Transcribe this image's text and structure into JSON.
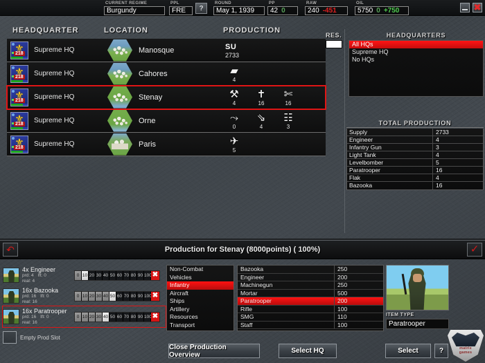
{
  "topbar": {
    "regime_label": "CURRENT REGIME",
    "regime_value": "Burgundy",
    "ppl_label": "PPL",
    "ppl_value": "FRE",
    "help_glyph": "?",
    "round_label": "ROUND",
    "round_value": "May 1, 1939",
    "pp_label": "PP",
    "pp_value": "42",
    "pp_delta": "0",
    "raw_label": "RAW",
    "raw_value": "240",
    "raw_delta": "-451",
    "oil_label": "OIL",
    "oil_value": "5750",
    "oil_delta": "0",
    "oil_delta2": "+750",
    "minimize_glyph": "",
    "close_glyph": "✖"
  },
  "hq_table": {
    "headers": {
      "headquarter": "HEADQUARTER",
      "location": "LOCATION",
      "production": "PRODUCTION"
    },
    "rows": [
      {
        "unit_name": "Supreme HQ",
        "unit_badge": "218",
        "terrain": "water",
        "location": "Manosque",
        "selected": false,
        "supply": {
          "label": "SU",
          "value": "2733"
        },
        "items": []
      },
      {
        "unit_name": "Supreme HQ",
        "unit_badge": "218",
        "terrain": "water",
        "location": "Cahores",
        "selected": false,
        "supply": null,
        "items": [
          {
            "icon": "light-tank-icon",
            "glyph": "▰",
            "count": "4"
          }
        ]
      },
      {
        "unit_name": "Supreme HQ",
        "unit_badge": "218",
        "terrain": "land",
        "location": "Stenay",
        "selected": true,
        "supply": null,
        "items": [
          {
            "icon": "engineer-icon",
            "glyph": "⚒",
            "count": "4"
          },
          {
            "icon": "bazooka-icon",
            "glyph": "✝",
            "count": "16"
          },
          {
            "icon": "paratrooper-icon",
            "glyph": "✄",
            "count": "16"
          }
        ]
      },
      {
        "unit_name": "Supreme HQ",
        "unit_badge": "218",
        "terrain": "land2",
        "location": "Orne",
        "selected": false,
        "supply": null,
        "items": [
          {
            "icon": "flak-icon",
            "glyph": "⤳",
            "count": "0"
          },
          {
            "icon": "infantry-gun-icon",
            "glyph": "⇘",
            "count": "4"
          },
          {
            "icon": "light-tank-icon",
            "glyph": "☷",
            "count": "3"
          }
        ]
      },
      {
        "unit_name": "Supreme HQ",
        "unit_badge": "218",
        "terrain": "city",
        "location": "Paris",
        "selected": false,
        "supply": null,
        "items": [
          {
            "icon": "levelbomber-icon",
            "glyph": "✈",
            "count": "5"
          }
        ]
      }
    ]
  },
  "res": {
    "label": "RES.",
    "value": ""
  },
  "hq_filter": {
    "title": "HEADQUARTERS",
    "options": [
      {
        "label": "All HQs",
        "selected": true
      },
      {
        "label": "Supreme HQ",
        "selected": false
      },
      {
        "label": "No HQs",
        "selected": false
      }
    ]
  },
  "total_production": {
    "title": "TOTAL PRODUCTION",
    "rows": [
      {
        "name": "Supply",
        "value": "2733"
      },
      {
        "name": "Engineer",
        "value": "4"
      },
      {
        "name": "Infantry Gun",
        "value": "3"
      },
      {
        "name": "Light Tank",
        "value": "4"
      },
      {
        "name": "Levelbomber",
        "value": "5"
      },
      {
        "name": "Paratrooper",
        "value": "16"
      },
      {
        "name": "Flak",
        "value": "4"
      },
      {
        "name": "Bazooka",
        "value": "16"
      }
    ]
  },
  "production_panel": {
    "title": "Production for Stenay (8000points) ( 100%)",
    "back_glyph": "↶",
    "ok_glyph": "✓",
    "slots": [
      {
        "title": "4x Engineer",
        "prd": "prd: 4",
        "lft": "lft: 0",
        "real": "real: 4",
        "percent": 10,
        "selected": false,
        "remove_glyph": "✖"
      },
      {
        "title": "16x Bazooka",
        "prd": "prd: 16",
        "lft": "lft: 0",
        "real": "real: 16",
        "percent": 50,
        "selected": false,
        "remove_glyph": "✖"
      },
      {
        "title": "16x Paratrooper",
        "prd": "prd: 16",
        "lft": "lft: 0",
        "real": "real: 16",
        "percent": 40,
        "selected": true,
        "remove_glyph": "✖"
      }
    ],
    "slider_ticks": [
      "0",
      "10",
      "20",
      "30",
      "40",
      "50",
      "60",
      "70",
      "80",
      "90",
      "100"
    ],
    "empty_slot_label": "Empty Prod Slot",
    "categories": [
      {
        "label": "Non-Combat",
        "selected": false
      },
      {
        "label": "Vehicles",
        "selected": false
      },
      {
        "label": "Infantry",
        "selected": true
      },
      {
        "label": "Aircraft",
        "selected": false
      },
      {
        "label": "Ships",
        "selected": false
      },
      {
        "label": "Artillery",
        "selected": false
      },
      {
        "label": "Resources",
        "selected": false
      },
      {
        "label": "Transport",
        "selected": false
      }
    ],
    "items": [
      {
        "name": "Bazooka",
        "cost": "250",
        "selected": false
      },
      {
        "name": "Engineer",
        "cost": "200",
        "selected": false
      },
      {
        "name": "Machinegun",
        "cost": "250",
        "selected": false
      },
      {
        "name": "Mortar",
        "cost": "500",
        "selected": false
      },
      {
        "name": "Paratrooper",
        "cost": "200",
        "selected": true
      },
      {
        "name": "Rifle",
        "cost": "100",
        "selected": false
      },
      {
        "name": "SMG",
        "cost": "110",
        "selected": false
      },
      {
        "name": "Staff",
        "cost": "100",
        "selected": false
      }
    ],
    "item_type_label": "ITEM TYPE",
    "item_type_value": "Paratrooper"
  },
  "footer": {
    "close_production_overview": "Close Production Overview",
    "select_hq": "Select HQ",
    "select": "Select",
    "help": "?"
  },
  "logo": {
    "line1": "matrix",
    "line2": "games"
  },
  "colors": {
    "accent_red": "#e01515",
    "highlight_red": "#ff1212",
    "positive_green": "#4fcc4f",
    "negative_red": "#e12020"
  }
}
